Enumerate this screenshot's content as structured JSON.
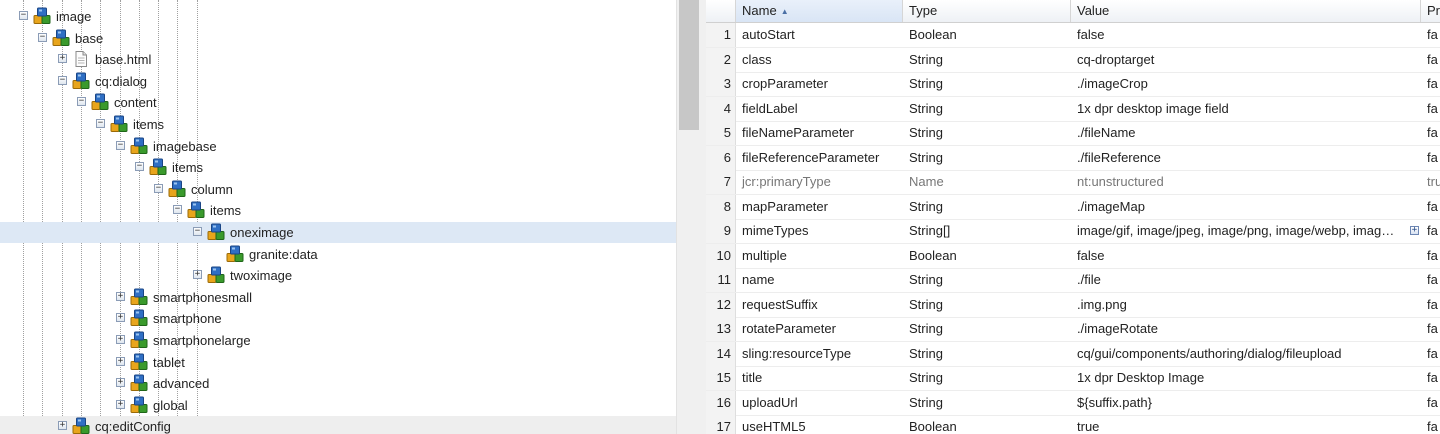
{
  "tree": {
    "nodes": [
      {
        "id": "image",
        "label": "image",
        "level": 0,
        "toggle": "minus",
        "icon": "jcr-node-icon"
      },
      {
        "id": "base",
        "label": "base",
        "level": 1,
        "toggle": "minus",
        "icon": "jcr-node-icon"
      },
      {
        "id": "base-html",
        "label": "base.html",
        "level": 2,
        "toggle": "plus",
        "icon": "file-icon"
      },
      {
        "id": "cq-dialog",
        "label": "cq:dialog",
        "level": 2,
        "toggle": "minus",
        "icon": "jcr-node-icon"
      },
      {
        "id": "content",
        "label": "content",
        "level": 3,
        "toggle": "minus",
        "icon": "jcr-node-icon"
      },
      {
        "id": "items",
        "label": "items",
        "level": 4,
        "toggle": "minus",
        "icon": "jcr-node-icon"
      },
      {
        "id": "imagebase",
        "label": "imagebase",
        "level": 5,
        "toggle": "minus",
        "icon": "jcr-node-icon"
      },
      {
        "id": "items-2",
        "label": "items",
        "level": 6,
        "toggle": "minus",
        "icon": "jcr-node-icon"
      },
      {
        "id": "column",
        "label": "column",
        "level": 7,
        "toggle": "minus",
        "icon": "jcr-node-icon"
      },
      {
        "id": "items-3",
        "label": "items",
        "level": 8,
        "toggle": "minus",
        "icon": "jcr-node-icon"
      },
      {
        "id": "oneximage",
        "label": "oneximage",
        "level": 9,
        "toggle": "minus",
        "icon": "jcr-node-icon",
        "selected": true
      },
      {
        "id": "granite-data",
        "label": "granite:data",
        "level": 10,
        "toggle": "none",
        "icon": "jcr-node-icon"
      },
      {
        "id": "twoximage",
        "label": "twoximage",
        "level": 9,
        "toggle": "plus",
        "icon": "jcr-node-icon"
      },
      {
        "id": "smartphonesmall",
        "label": "smartphonesmall",
        "level": 5,
        "toggle": "plus",
        "icon": "jcr-node-icon"
      },
      {
        "id": "smartphone",
        "label": "smartphone",
        "level": 5,
        "toggle": "plus",
        "icon": "jcr-node-icon"
      },
      {
        "id": "smartphonelarge",
        "label": "smartphonelarge",
        "level": 5,
        "toggle": "plus",
        "icon": "jcr-node-icon"
      },
      {
        "id": "tablet",
        "label": "tablet",
        "level": 5,
        "toggle": "plus",
        "icon": "jcr-node-icon"
      },
      {
        "id": "advanced",
        "label": "advanced",
        "level": 5,
        "toggle": "plus",
        "icon": "jcr-node-icon"
      },
      {
        "id": "global",
        "label": "global",
        "level": 5,
        "toggle": "plus",
        "icon": "jcr-node-icon"
      },
      {
        "id": "cq-editconfig",
        "label": "cq:editConfig",
        "level": 2,
        "toggle": "plus",
        "icon": "jcr-node-icon",
        "hover": true
      }
    ]
  },
  "properties": {
    "columns": {
      "name": "Name",
      "type": "Type",
      "value": "Value",
      "protected": "Pr"
    },
    "sort_indicator": "▲",
    "rows": [
      {
        "num": "1",
        "name": "autoStart",
        "type": "Boolean",
        "value": "false",
        "protected": "fa"
      },
      {
        "num": "2",
        "name": "class",
        "type": "String",
        "value": "cq-droptarget",
        "protected": "fa"
      },
      {
        "num": "3",
        "name": "cropParameter",
        "type": "String",
        "value": "./imageCrop",
        "protected": "fa"
      },
      {
        "num": "4",
        "name": "fieldLabel",
        "type": "String",
        "value": "1x dpr desktop image field",
        "protected": "fa"
      },
      {
        "num": "5",
        "name": "fileNameParameter",
        "type": "String",
        "value": "./fileName",
        "protected": "fa"
      },
      {
        "num": "6",
        "name": "fileReferenceParameter",
        "type": "String",
        "value": "./fileReference",
        "protected": "fa"
      },
      {
        "num": "7",
        "name": "jcr:primaryType",
        "type": "Name",
        "value": "nt:unstructured",
        "protected": "tru",
        "muted": true
      },
      {
        "num": "8",
        "name": "mapParameter",
        "type": "String",
        "value": "./imageMap",
        "protected": "fa"
      },
      {
        "num": "9",
        "name": "mimeTypes",
        "type": "String[]",
        "value": "image/gif, image/jpeg, image/png, image/webp, imag…",
        "protected": "fa",
        "expandable": true
      },
      {
        "num": "10",
        "name": "multiple",
        "type": "Boolean",
        "value": "false",
        "protected": "fa"
      },
      {
        "num": "11",
        "name": "name",
        "type": "String",
        "value": "./file",
        "protected": "fa"
      },
      {
        "num": "12",
        "name": "requestSuffix",
        "type": "String",
        "value": ".img.png",
        "protected": "fa"
      },
      {
        "num": "13",
        "name": "rotateParameter",
        "type": "String",
        "value": "./imageRotate",
        "protected": "fa"
      },
      {
        "num": "14",
        "name": "sling:resourceType",
        "type": "String",
        "value": "cq/gui/components/authoring/dialog/fileupload",
        "protected": "fa"
      },
      {
        "num": "15",
        "name": "title",
        "type": "String",
        "value": "1x dpr Desktop Image",
        "protected": "fa"
      },
      {
        "num": "16",
        "name": "uploadUrl",
        "type": "String",
        "value": "${suffix.path}",
        "protected": "fa"
      },
      {
        "num": "17",
        "name": "useHTML5",
        "type": "Boolean",
        "value": "true",
        "protected": "fa"
      }
    ]
  }
}
